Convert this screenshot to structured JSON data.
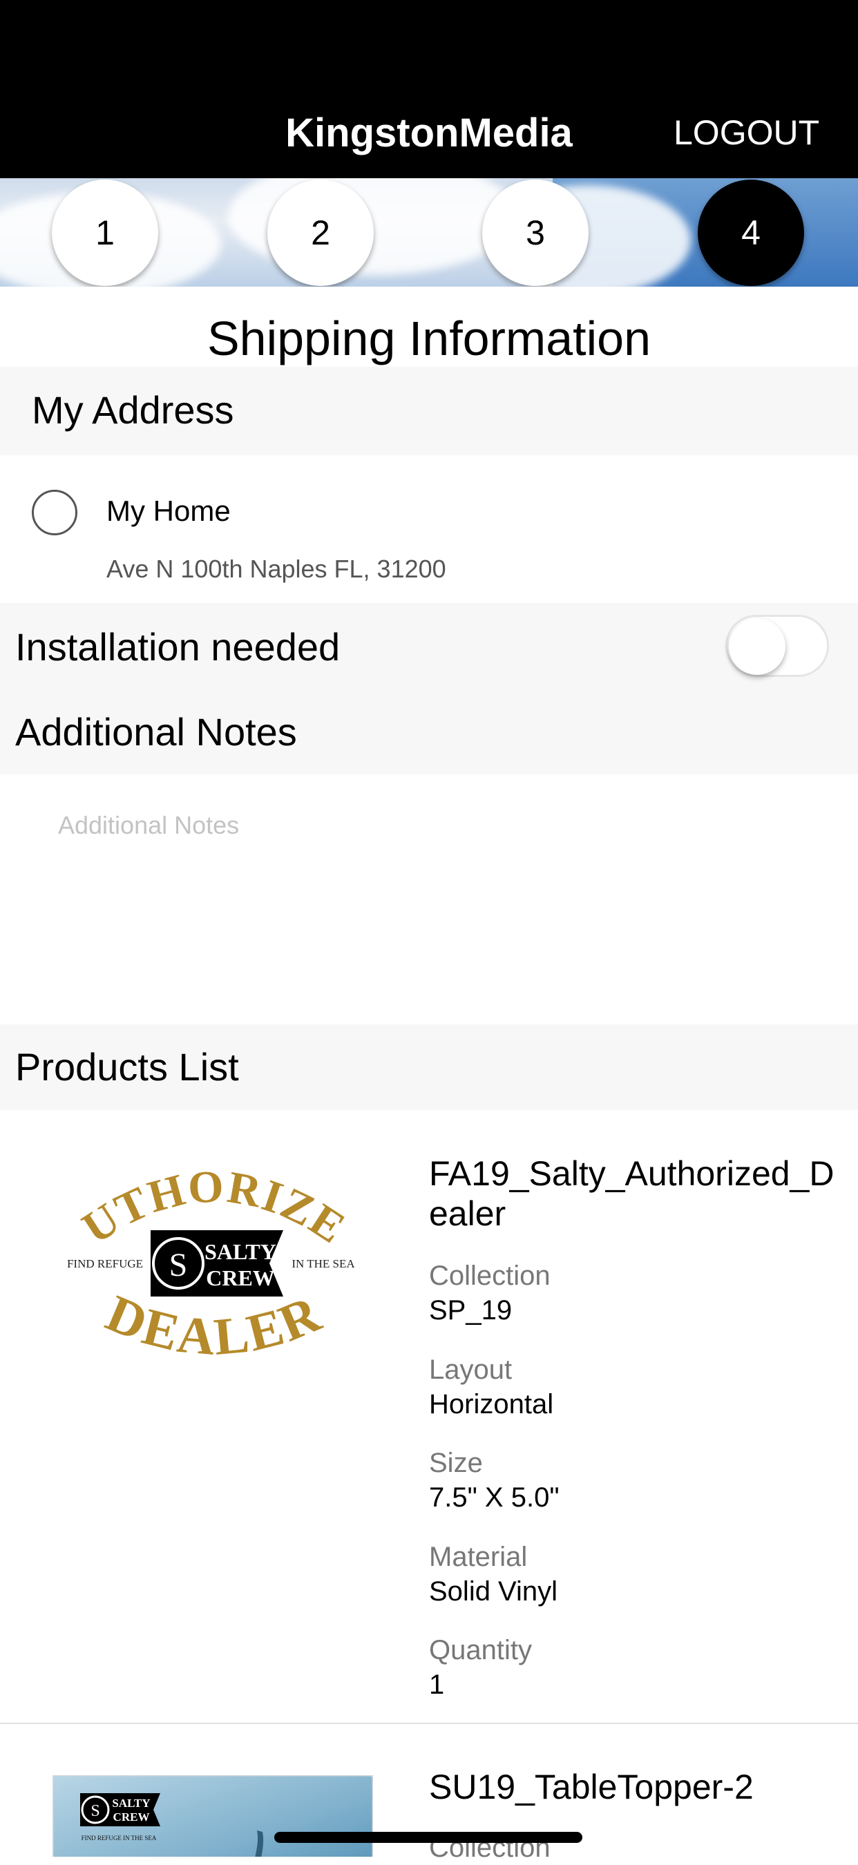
{
  "header": {
    "title": "KingstonMedia",
    "logout_label": "LOGOUT"
  },
  "steps": [
    {
      "label": "1",
      "active": false
    },
    {
      "label": "2",
      "active": false
    },
    {
      "label": "3",
      "active": false
    },
    {
      "label": "4",
      "active": true
    }
  ],
  "page": {
    "title": "Shipping Information"
  },
  "address": {
    "section_label": "My Address",
    "name": "My Home",
    "line": "Ave N 100th Naples FL, 31200",
    "selected": false
  },
  "installation": {
    "label": "Installation needed",
    "enabled": false
  },
  "notes": {
    "label": "Additional Notes",
    "placeholder": "Additional Notes",
    "value": ""
  },
  "products": {
    "section_label": "Products List",
    "items": [
      {
        "name": "FA19_Salty_Authorized_Dealer",
        "image_text": {
          "top": "AUTHORIZED",
          "left": "FIND REFUGE",
          "brand_line1": "SALTY",
          "brand_line2": "CREW",
          "right": "IN THE SEA",
          "bottom": "DEALER"
        },
        "fields": [
          {
            "label": "Collection",
            "value": "SP_19"
          },
          {
            "label": "Layout",
            "value": "Horizontal"
          },
          {
            "label": "Size",
            "value": "7.5\" X 5.0\""
          },
          {
            "label": "Material",
            "value": "Solid Vinyl"
          },
          {
            "label": "Quantity",
            "value": "1"
          }
        ]
      },
      {
        "name": "SU19_TableTopper-2",
        "image_text": {
          "brand_line1": "SALTY",
          "brand_line2": "CREW",
          "tag": "FIND REFUGE IN THE SEA"
        },
        "fields": [
          {
            "label": "Collection",
            "value": ""
          }
        ]
      }
    ]
  },
  "colors": {
    "gold": "#b58a2a",
    "header_bg": "#000000",
    "band_bg": "#f7f7f7",
    "label_gray": "#777777"
  }
}
